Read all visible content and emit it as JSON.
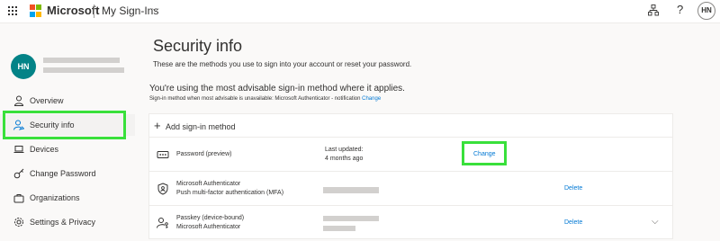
{
  "topbar": {
    "brand": "Microsoft",
    "app_title": "My Sign-Ins",
    "user_initials": "HN",
    "colors": {
      "ms_red": "#f25022",
      "ms_green": "#7fba00",
      "ms_blue": "#00a4ef",
      "ms_yellow": "#ffb900"
    }
  },
  "nav": {
    "user_initials": "HN",
    "items": [
      {
        "label": "Overview",
        "icon": "person-icon"
      },
      {
        "label": "Security info",
        "icon": "security-info-icon"
      },
      {
        "label": "Devices",
        "icon": "laptop-icon"
      },
      {
        "label": "Change Password",
        "icon": "key-icon"
      },
      {
        "label": "Organizations",
        "icon": "briefcase-icon"
      },
      {
        "label": "Settings & Privacy",
        "icon": "gear-icon"
      }
    ]
  },
  "main": {
    "title": "Security info",
    "subtitle": "These are the methods you use to sign into your account or reset your password.",
    "advisable_text": "You're using the most advisable sign-in method where it applies.",
    "default_text": "Sign-in method when most advisable is unavailable: Microsoft Authenticator - notification",
    "default_change": "Change",
    "add_method": "Add sign-in method",
    "methods": [
      {
        "name": "Password (preview)",
        "updated_label": "Last updated:",
        "updated_value": "4 months ago",
        "action": "Change"
      },
      {
        "name": "Microsoft Authenticator",
        "detail": "Push multi-factor authentication (MFA)",
        "action": "Delete"
      },
      {
        "name": "Passkey (device-bound)",
        "detail": "Microsoft Authenticator",
        "action": "Delete"
      }
    ]
  },
  "accent_color": "#0078d4",
  "highlight_color": "#39e03b"
}
